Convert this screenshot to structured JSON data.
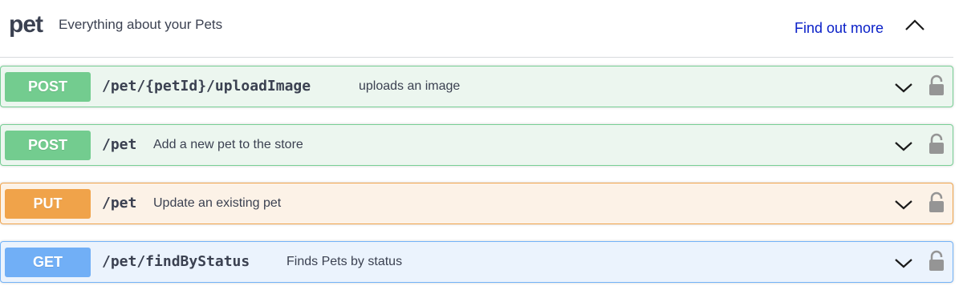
{
  "tag": {
    "name": "pet",
    "description": "Everything about your Pets",
    "link_label": "Find out more"
  },
  "operations": [
    {
      "method": "POST",
      "path": "/pet/{petId}/uploadImage",
      "summary": "uploads an image"
    },
    {
      "method": "POST",
      "path": "/pet",
      "summary": "Add a new pet to the store"
    },
    {
      "method": "PUT",
      "path": "/pet",
      "summary": "Update an existing pet"
    },
    {
      "method": "GET",
      "path": "/pet/findByStatus",
      "summary": "Finds Pets by status"
    }
  ],
  "icons": {
    "collapse": "chevron-up-icon",
    "expand": "chevron-down-icon",
    "lock": "lock-icon"
  },
  "colors": {
    "post": "#73cc8f",
    "put": "#f0a34a",
    "get": "#71aff6",
    "link": "#0b21c8"
  }
}
